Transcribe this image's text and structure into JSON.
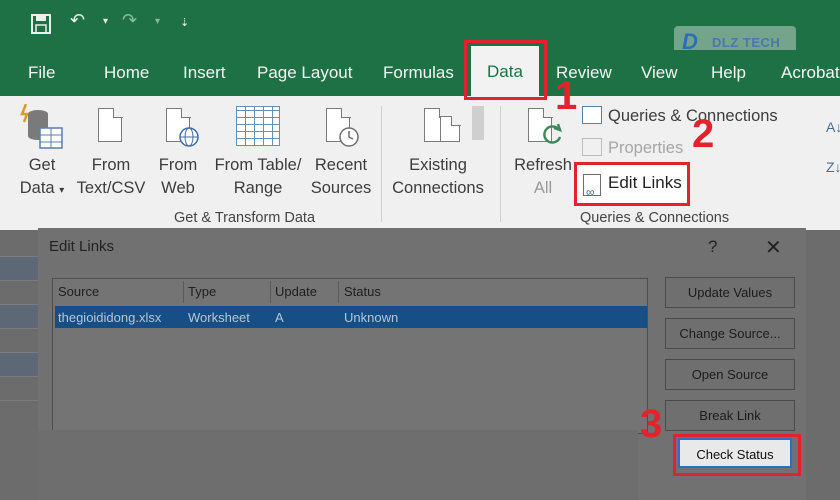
{
  "qat": {
    "save_icon": "save-icon",
    "undo_icon": "undo-icon",
    "redo_icon": "redo-icon",
    "customize_icon": "customize-qat-icon"
  },
  "tabs": {
    "file": "File",
    "home": "Home",
    "insert": "Insert",
    "page_layout": "Page Layout",
    "formulas": "Formulas",
    "data": "Data",
    "review": "Review",
    "view": "View",
    "help": "Help",
    "acrobat": "Acrobat"
  },
  "ribbon": {
    "get_data": [
      "Get",
      "Data"
    ],
    "from_text": [
      "From",
      "Text/CSV"
    ],
    "from_web": [
      "From",
      "Web"
    ],
    "from_table": [
      "From Table/",
      "Range"
    ],
    "recent_sources": [
      "Recent",
      "Sources"
    ],
    "existing_connections": [
      "Existing",
      "Connections"
    ],
    "group_get_transform": "Get & Transform Data",
    "refresh_all": [
      "Refresh",
      "All"
    ],
    "queries_connections": "Queries & Connections",
    "properties": "Properties",
    "edit_links": "Edit Links",
    "group_queries": "Queries & Connections"
  },
  "badges": {
    "one": "1",
    "two": "2",
    "three": "3"
  },
  "dialog": {
    "title": "Edit Links",
    "help": "?",
    "close": "✕",
    "columns": [
      "Source",
      "Type",
      "Update",
      "Status"
    ],
    "rows": [
      {
        "source": "thegioididong.xlsx",
        "type": "Worksheet",
        "update": "A",
        "status": "Unknown"
      }
    ],
    "buttons": {
      "update_values": "Update Values",
      "change_source": "Change Source...",
      "open_source": "Open Source",
      "break_link": "Break Link",
      "check_status": "Check Status"
    }
  },
  "colors": {
    "excel_green": "#1e7145",
    "highlight_red": "#e4222b",
    "selection_blue": "#164f86"
  }
}
